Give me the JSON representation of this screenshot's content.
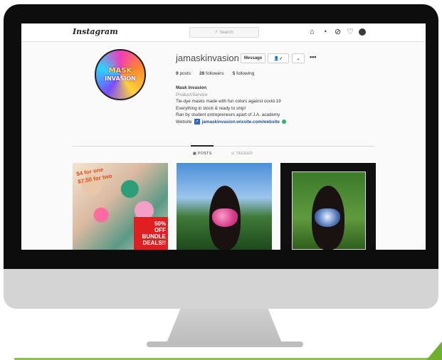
{
  "app": {
    "logo": "Instagram",
    "search_placeholder": "Search"
  },
  "nav_icons": [
    "home-icon",
    "messenger-icon",
    "explore-icon",
    "heart-icon",
    "profile-avatar"
  ],
  "profile": {
    "username": "jamaskinvasion",
    "message_label": "Message",
    "avatar_text_line1": "MASK",
    "avatar_text_line2": "INVASION",
    "stats": {
      "posts_count": "9",
      "posts_label": "posts",
      "followers_count": "28",
      "followers_label": "followers",
      "following_count": "5",
      "following_label": "following"
    },
    "bio": {
      "name": "Mask Invasion",
      "category": "Product/Service",
      "line1": "Tie-dye masks made with fun colors against covid-19",
      "line2": "Everything in stock & ready to ship!",
      "line3": "Ran by student entrepreneurs apart of J.A. academy",
      "website_label": "Website",
      "website_url": "jamaskinvasion.wixsite.com/website"
    }
  },
  "tabs": [
    {
      "label": "POSTS",
      "active": true
    },
    {
      "label": "TAGGED",
      "active": false
    }
  ],
  "posts": {
    "p1": {
      "promo_line1": "$4 for one",
      "promo_line2": "$7.50 for two",
      "sale_line1": "50%",
      "sale_line2": "OFF",
      "sale_line3": "BUNDLE",
      "sale_line4": "DEALS!!"
    }
  },
  "colors": {
    "bezel": "#0d0d0d",
    "chin": "#d4d4d4",
    "accent_green": "#8cc63f",
    "link_blue": "#1d4f96"
  }
}
